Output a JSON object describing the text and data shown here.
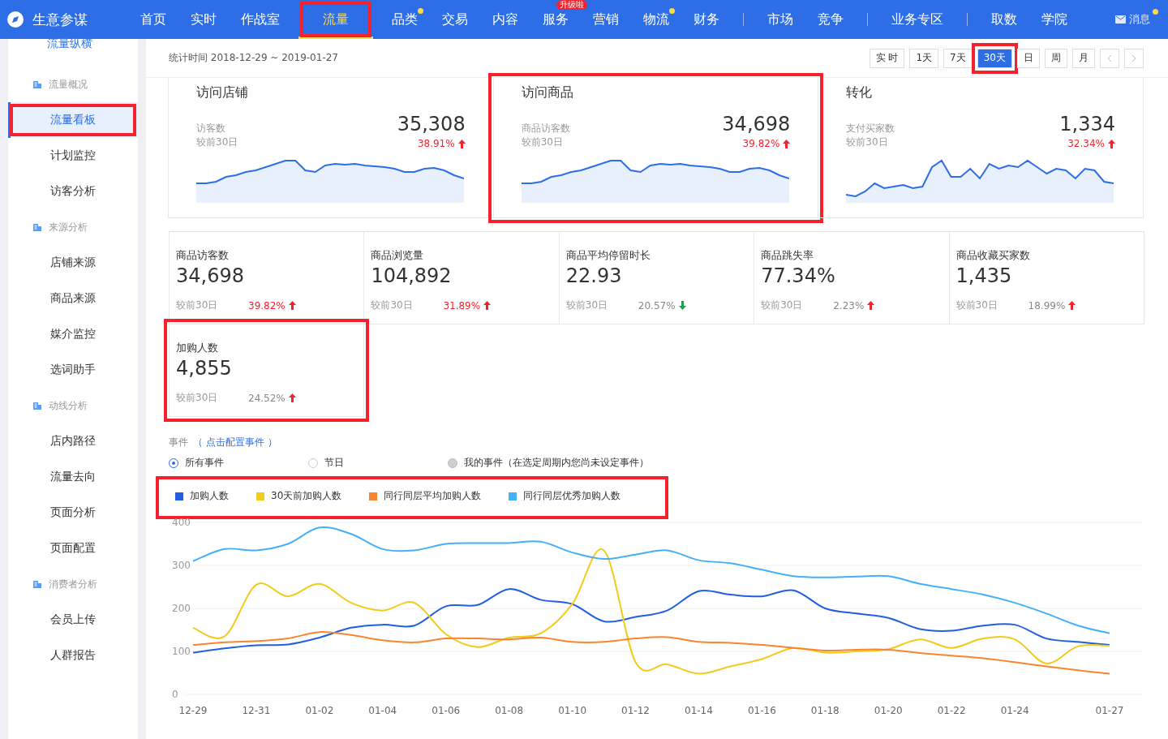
{
  "brand": {
    "title": "生意参谋"
  },
  "nav": {
    "groups": [
      [
        {
          "label": "首页",
          "selected": false,
          "dot": false,
          "annotated": false
        },
        {
          "label": "实时",
          "selected": false,
          "dot": false,
          "annotated": false
        },
        {
          "label": "作战室",
          "selected": false,
          "dot": false,
          "annotated": false
        },
        {
          "label": "流量",
          "selected": true,
          "dot": false,
          "annotated": true
        },
        {
          "label": "品类",
          "selected": false,
          "dot": true,
          "annotated": false
        },
        {
          "label": "交易",
          "selected": false,
          "dot": false,
          "annotated": false
        },
        {
          "label": "内容",
          "selected": false,
          "dot": false,
          "annotated": false
        },
        {
          "label": "服务",
          "selected": false,
          "dot": false,
          "annotated": false,
          "badge": "升级啦"
        },
        {
          "label": "营销",
          "selected": false,
          "dot": false,
          "annotated": false
        },
        {
          "label": "物流",
          "selected": false,
          "dot": true,
          "annotated": false
        },
        {
          "label": "财务",
          "selected": false,
          "dot": false,
          "annotated": false
        }
      ],
      [
        {
          "label": "市场",
          "selected": false,
          "dot": false,
          "annotated": false
        },
        {
          "label": "竞争",
          "selected": false,
          "dot": false,
          "annotated": false
        }
      ],
      [
        {
          "label": "业务专区",
          "selected": false,
          "dot": false,
          "annotated": false
        }
      ],
      [
        {
          "label": "取数",
          "selected": false,
          "dot": false,
          "annotated": false
        },
        {
          "label": "学院",
          "selected": false,
          "dot": false,
          "annotated": false
        }
      ]
    ],
    "messages": {
      "label": "消息",
      "unread": true
    }
  },
  "sidebar": {
    "title": "流量纵横",
    "sections": [
      {
        "heading": "流量概况",
        "items": [
          {
            "label": "流量看板",
            "selected": true,
            "annotated": true
          },
          {
            "label": "计划监控",
            "selected": false,
            "annotated": false
          },
          {
            "label": "访客分析",
            "selected": false,
            "annotated": false
          }
        ]
      },
      {
        "heading": "来源分析",
        "items": [
          {
            "label": "店铺来源",
            "selected": false,
            "annotated": false
          },
          {
            "label": "商品来源",
            "selected": false,
            "annotated": false
          },
          {
            "label": "媒介监控",
            "selected": false,
            "annotated": false
          },
          {
            "label": "选词助手",
            "selected": false,
            "annotated": false
          }
        ]
      },
      {
        "heading": "动线分析",
        "items": [
          {
            "label": "店内路径",
            "selected": false,
            "annotated": false
          },
          {
            "label": "流量去向",
            "selected": false,
            "annotated": false
          },
          {
            "label": "页面分析",
            "selected": false,
            "annotated": false
          },
          {
            "label": "页面配置",
            "selected": false,
            "annotated": false
          }
        ]
      },
      {
        "heading": "消费者分析",
        "items": [
          {
            "label": "会员上传",
            "selected": false,
            "annotated": false
          },
          {
            "label": "人群报告",
            "selected": false,
            "annotated": false
          }
        ]
      }
    ]
  },
  "period": {
    "label": "统计时间 2018-12-29 ~ 2019-01-27",
    "ranges": [
      {
        "label": "实 时",
        "selected": false,
        "annotated": false
      },
      {
        "label": "1天",
        "selected": false,
        "annotated": false
      },
      {
        "label": "7天",
        "selected": false,
        "annotated": false
      },
      {
        "label": "30天",
        "selected": true,
        "annotated": true
      },
      {
        "label": "日",
        "selected": false,
        "annotated": false
      },
      {
        "label": "周",
        "selected": false,
        "annotated": false
      },
      {
        "label": "月",
        "selected": false,
        "annotated": false
      }
    ]
  },
  "summary_cards": [
    {
      "title": "访问店铺",
      "metric": "访客数",
      "value": "35,308",
      "compare": "较前30日",
      "change": "38.91%",
      "rising": true,
      "annotated": false
    },
    {
      "title": "访问商品",
      "metric": "商品访客数",
      "value": "34,698",
      "compare": "较前30日",
      "change": "39.82%",
      "rising": true,
      "annotated": true
    },
    {
      "title": "转化",
      "metric": "支付买家数",
      "value": "1,334",
      "compare": "较前30日",
      "change": "32.34%",
      "rising": true,
      "annotated": false
    }
  ],
  "metrics": [
    {
      "name": "商品访客数",
      "value": "34,698",
      "compare": "较前30日",
      "change": "39.82%",
      "rising": true,
      "highlight": true,
      "annotated": false
    },
    {
      "name": "商品浏览量",
      "value": "104,892",
      "compare": "较前30日",
      "change": "31.89%",
      "rising": true,
      "highlight": true,
      "annotated": false
    },
    {
      "name": "商品平均停留时长",
      "value": "22.93",
      "compare": "较前30日",
      "change": "20.57%",
      "rising": false,
      "highlight": false,
      "annotated": false
    },
    {
      "name": "商品跳失率",
      "value": "77.34%",
      "compare": "较前30日",
      "change": "2.23%",
      "rising": true,
      "highlight": false,
      "annotated": false
    },
    {
      "name": "商品收藏买家数",
      "value": "1,435",
      "compare": "较前30日",
      "change": "18.99%",
      "rising": true,
      "highlight": false,
      "annotated": false
    },
    {
      "name": "加购人数",
      "value": "4,855",
      "compare": "较前30日",
      "change": "24.52%",
      "rising": true,
      "highlight": false,
      "annotated": true
    }
  ],
  "events": {
    "label": "事件",
    "link": "（ 点击配置事件 ）",
    "options": [
      {
        "label": "所有事件",
        "selected": true,
        "disabled": false
      },
      {
        "label": "节日",
        "selected": false,
        "disabled": false
      },
      {
        "label": "我的事件（在选定周期内您尚未设定事件）",
        "selected": false,
        "disabled": true
      }
    ]
  },
  "legend_annotated": true,
  "chart_data": {
    "type": "line",
    "grid": true,
    "x": [
      "12-29",
      null,
      "12-31",
      null,
      "01-02",
      null,
      "01-04",
      null,
      "01-06",
      null,
      "01-08",
      null,
      "01-10",
      null,
      "01-12",
      null,
      "01-14",
      null,
      "01-16",
      null,
      "01-18",
      null,
      "01-20",
      null,
      "01-22",
      null,
      "01-24",
      null,
      null,
      "01-27"
    ],
    "ylim": [
      0,
      400
    ],
    "yticks": [
      0,
      100,
      200,
      300,
      400
    ],
    "series": [
      {
        "name": "加购人数",
        "color": "#1f5fe0",
        "values": [
          97,
          107,
          114,
          116,
          132,
          155,
          162,
          160,
          205,
          208,
          245,
          220,
          210,
          170,
          180,
          195,
          240,
          232,
          228,
          242,
          200,
          188,
          178,
          152,
          148,
          160,
          162,
          130,
          122,
          115
        ]
      },
      {
        "name": "30天前加购人数",
        "color": "#f2cc1a",
        "values": [
          155,
          135,
          255,
          228,
          257,
          213,
          195,
          213,
          140,
          110,
          132,
          142,
          210,
          335,
          75,
          70,
          48,
          65,
          82,
          108,
          97,
          100,
          105,
          128,
          108,
          130,
          128,
          72,
          112,
          113
        ]
      },
      {
        "name": "同行同层平均加购人数",
        "color": "#fa8530",
        "values": [
          115,
          121,
          124,
          130,
          145,
          138,
          126,
          121,
          130,
          130,
          128,
          132,
          122,
          122,
          130,
          133,
          122,
          120,
          115,
          108,
          102,
          104,
          104,
          96,
          90,
          84,
          75,
          65,
          56,
          48
        ]
      },
      {
        "name": "同行同层优秀加购人数",
        "color": "#45b0fa",
        "values": [
          310,
          338,
          335,
          350,
          388,
          373,
          338,
          335,
          350,
          352,
          352,
          355,
          330,
          315,
          325,
          335,
          312,
          305,
          290,
          275,
          272,
          274,
          275,
          257,
          245,
          232,
          213,
          188,
          160,
          142
        ]
      }
    ]
  }
}
